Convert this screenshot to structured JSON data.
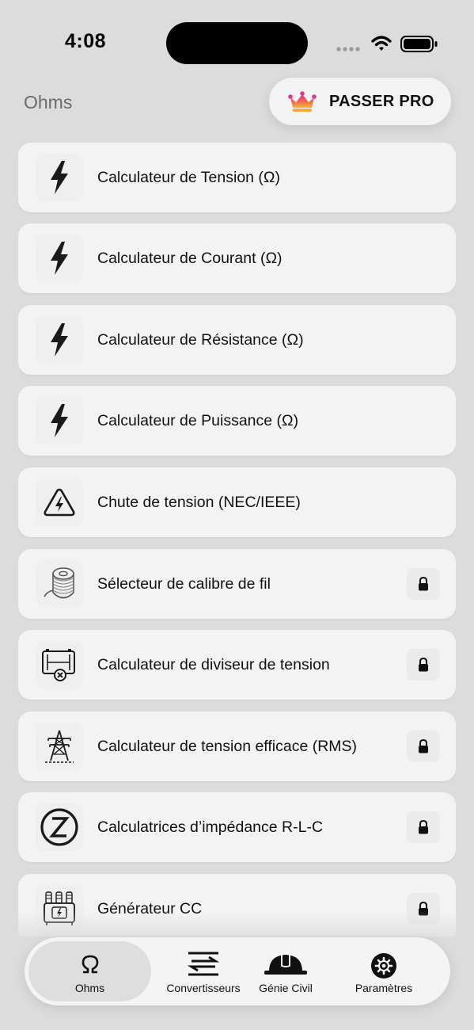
{
  "status_bar": {
    "time": "4:08"
  },
  "header": {
    "title": "Ohms",
    "pro_button_label": "PASSER PRO"
  },
  "items": [
    {
      "label": "Calculateur de Tension (Ω)",
      "icon": "lightning-icon",
      "locked": false
    },
    {
      "label": "Calculateur de Courant (Ω)",
      "icon": "lightning-icon",
      "locked": false
    },
    {
      "label": "Calculateur de Résistance (Ω)",
      "icon": "lightning-icon",
      "locked": false
    },
    {
      "label": "Calculateur de Puissance (Ω)",
      "icon": "lightning-icon",
      "locked": false
    },
    {
      "label": "Chute de tension (NEC/IEEE)",
      "icon": "warning-voltage-icon",
      "locked": false
    },
    {
      "label": "Sélecteur de calibre de fil",
      "icon": "wire-spool-icon",
      "locked": true
    },
    {
      "label": "Calculateur de diviseur de tension",
      "icon": "voltage-divider-icon",
      "locked": true
    },
    {
      "label": "Calculateur de tension efficace (RMS)",
      "icon": "power-tower-icon",
      "locked": true
    },
    {
      "label": "Calculatrices d’impédance R-L-C",
      "icon": "impedance-z-icon",
      "locked": true
    },
    {
      "label": "Générateur CC",
      "icon": "generator-icon",
      "locked": true
    }
  ],
  "tabs": [
    {
      "label": "Ohms",
      "icon": "omega-icon",
      "active": true
    },
    {
      "label": "Convertisseurs",
      "icon": "swap-arrows-icon",
      "active": false
    },
    {
      "label": "Génie Civil",
      "icon": "hard-hat-icon",
      "active": false
    },
    {
      "label": "Paramètres",
      "icon": "gear-icon",
      "active": false
    }
  ],
  "colors": {
    "background": "#dcdcdc",
    "card": "#f3f3f3",
    "text": "#111111",
    "title": "#6b6b6b",
    "crown_gradient_start": "#f7b733",
    "crown_gradient_end": "#e0308a"
  }
}
